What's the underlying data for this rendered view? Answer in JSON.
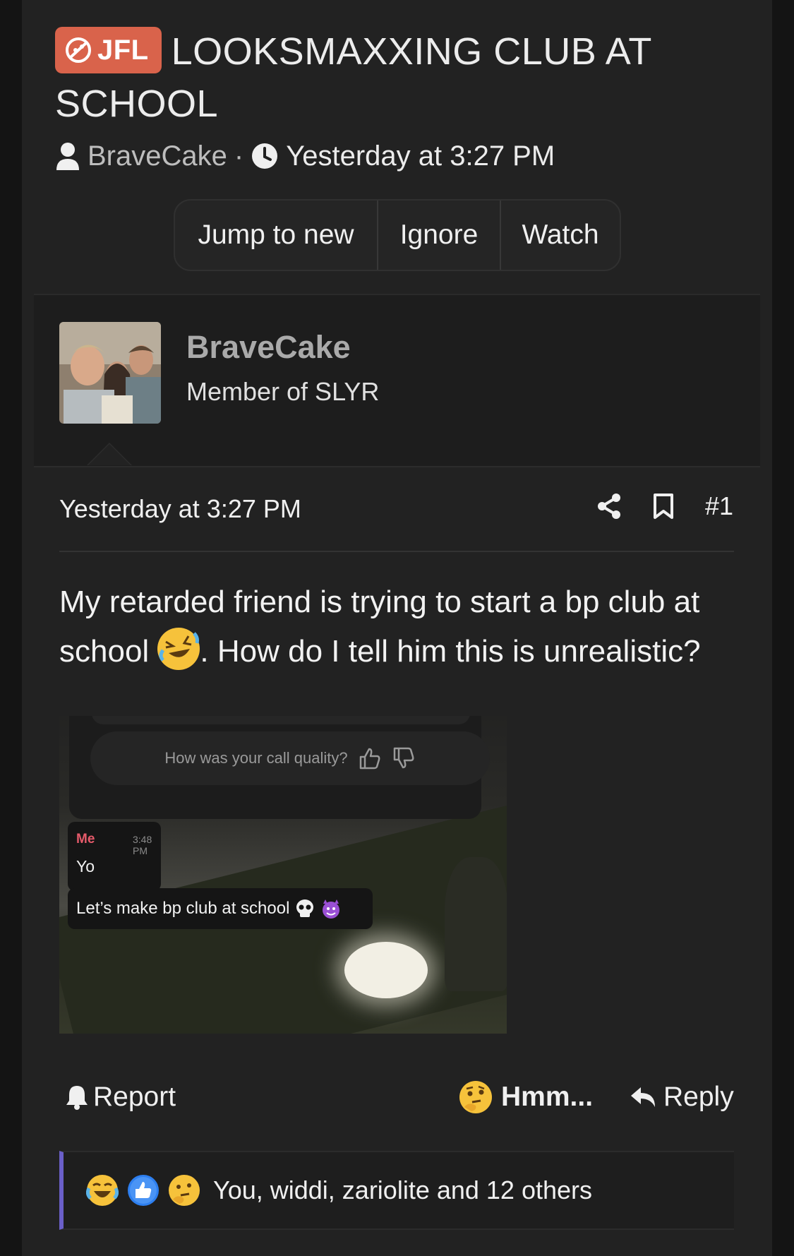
{
  "thread": {
    "prefix_label": "JFL",
    "title": "LOOKSMAXXING CLUB AT SCHOOL",
    "author": "BraveCake",
    "separator": "·",
    "time": "Yesterday at 3:27 PM"
  },
  "toolbar": {
    "jump_label": "Jump to new",
    "ignore_label": "Ignore",
    "watch_label": "Watch"
  },
  "user": {
    "name": "BraveCake",
    "title": "Member of SLYR"
  },
  "post": {
    "time": "Yesterday at 3:27 PM",
    "number": "#1",
    "text_part1": "My retarded friend is trying to start a bp club at school",
    "text_part2": ". How do I tell him this is unrealistic?"
  },
  "attachment": {
    "call_quality_prompt": "How was your call quality?",
    "sender": "Me",
    "msg_time": "3:48 PM",
    "msg1": "Yo",
    "msg2": "Let’s make bp club at school"
  },
  "actions": {
    "report_label": "Report",
    "reaction_label": "Hmm...",
    "reply_label": "Reply"
  },
  "reactions": {
    "summary": "You, widdi, zariolite and 12 others",
    "icons": [
      "crying-laughing-icon",
      "like-icon",
      "thinking-icon"
    ]
  },
  "colors": {
    "prefix_bg": "#d9634b",
    "reaction_accent": "#6a5fc8"
  }
}
